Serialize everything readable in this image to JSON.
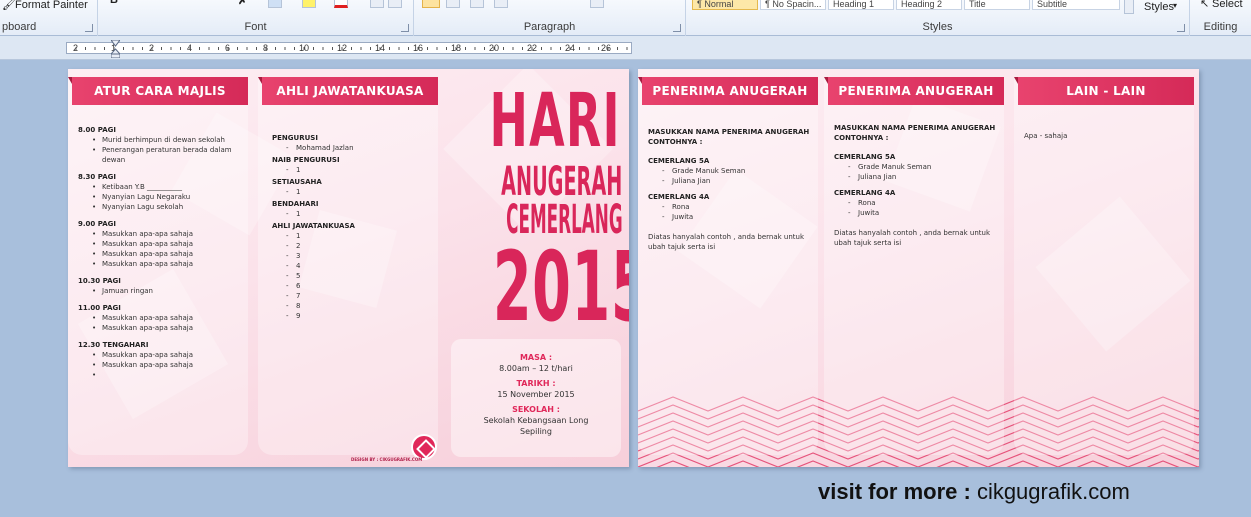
{
  "ribbon": {
    "clipboard_btn": "Format Painter",
    "clipboard_label": "pboard",
    "font_label": "Font",
    "paragraph_label": "Paragraph",
    "styles_label": "Styles",
    "editing_label": "Editing",
    "styles_btn": "Styles",
    "select_btn": "Select",
    "style_items": [
      "¶ Normal",
      "¶ No Spacin...",
      "Heading 1",
      "Heading 2",
      "Title",
      "Subtitle"
    ]
  },
  "ruler": {
    "numbers": [
      "2",
      "1",
      "2",
      "4",
      "6",
      "8",
      "10",
      "12",
      "14",
      "16",
      "18",
      "20",
      "22",
      "24",
      "26"
    ]
  },
  "page1": {
    "atur": {
      "title": "ATUR CARA MAJLIS",
      "sections": [
        {
          "time": "8.00 PAGI",
          "items": [
            "Murid berhimpun di dewan sekolah",
            "Penerangan peraturan berada dalam dewan"
          ]
        },
        {
          "time": "8.30 PAGI",
          "items": [
            "Ketibaan Y.B __________",
            "Nyanyian Lagu Negaraku",
            "Nyanyian Lagu sekolah"
          ]
        },
        {
          "time": "9.00 PAGI",
          "items": [
            "Masukkan apa-apa sahaja",
            "Masukkan apa-apa sahaja",
            "Masukkan apa-apa sahaja",
            "Masukkan apa-apa sahaja"
          ]
        },
        {
          "time": "10.30 PAGI",
          "items": [
            "Jamuan ringan"
          ]
        },
        {
          "time": "11.00 PAGI",
          "items": [
            "Masukkan apa-apa sahaja",
            "Masukkan apa-apa sahaja"
          ]
        },
        {
          "time": "12.30 TENGAHARI",
          "items": [
            "Masukkan apa-apa sahaja",
            "Masukkan apa-apa sahaja",
            ""
          ]
        }
      ]
    },
    "ajk": {
      "title": "AHLI JAWATANKUASA",
      "sections": [
        {
          "role": "PENGURUSI",
          "items": [
            "Mohamad Jazlan"
          ]
        },
        {
          "role": "NAIB PENGURUSI",
          "items": [
            "1"
          ]
        },
        {
          "role": "SETIAUSAHA",
          "items": [
            "1"
          ]
        },
        {
          "role": "BENDAHARI",
          "items": [
            "1"
          ]
        },
        {
          "role": "AHLI JAWATANKUASA",
          "items": [
            "1",
            "2",
            "3",
            "4",
            "5",
            "6",
            "7",
            "8",
            "9"
          ]
        }
      ]
    },
    "cover": {
      "line1": "HARI",
      "line2": "ANUGERAH",
      "line3": "CEMERLANG",
      "year": "2015",
      "masa_label": "MASA :",
      "masa_value": "8.00am – 12 t/hari",
      "tarikh_label": "TARIKH :",
      "tarikh_value": "15 November 2015",
      "sekolah_label": "SEKOLAH :",
      "sekolah_value": "Sekolah Kebangsaan Long Sepiling",
      "credit": "DESIGN BY : CIKGUGRAFIK.COM"
    }
  },
  "page2": {
    "penerima1": {
      "title": "PENERIMA ANUGERAH",
      "intro": "MASUKKAN NAMA PENERIMA ANUGERAH CONTOHNYA :",
      "groups": [
        {
          "name": "CEMERLANG 5A",
          "items": [
            "Grade Manuk Seman",
            "Juliana Jian"
          ]
        },
        {
          "name": "CEMERLANG 4A",
          "items": [
            "Rona",
            "Juwita"
          ]
        }
      ],
      "note": "Diatas hanyalah contoh , anda bernak untuk ubah tajuk serta isi"
    },
    "penerima2": {
      "title": "PENERIMA ANUGERAH",
      "intro": "MASUKKAN NAMA PENERIMA ANUGERAH CONTOHNYA :",
      "groups": [
        {
          "name": "CEMERLANG 5A",
          "items": [
            "Grade Manuk Seman",
            "Juliana Jian"
          ]
        },
        {
          "name": "CEMERLANG 4A",
          "items": [
            "Rona",
            "Juwita"
          ]
        }
      ],
      "note": "Diatas hanyalah contoh , anda bernak untuk ubah tajuk serta isi"
    },
    "lain": {
      "title": "LAIN - LAIN",
      "text": "Apa - sahaja"
    }
  },
  "footer": {
    "visit_label": "visit for more :",
    "site": "cikgugrafik.com"
  },
  "colors": {
    "accent": "#e0285a",
    "ribbon_bg": "#e4ecf7",
    "workspace": "#a8bfdc"
  }
}
